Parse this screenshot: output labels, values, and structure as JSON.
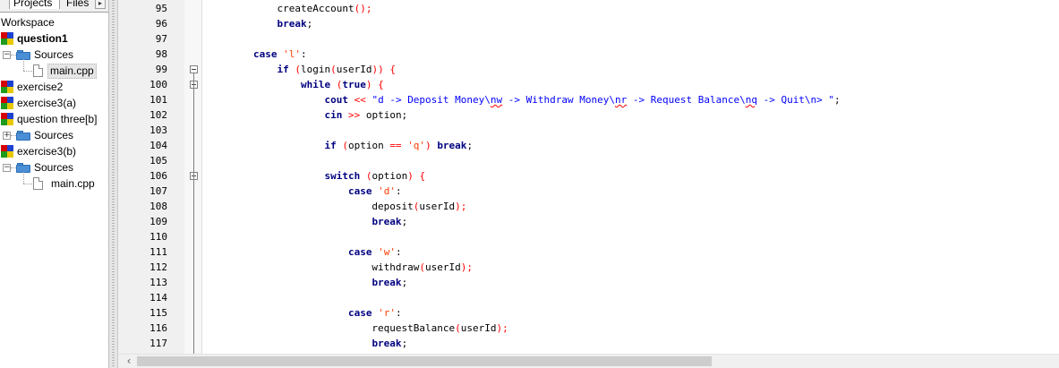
{
  "left_pane": {
    "tabs": [
      "Projects",
      "Files"
    ],
    "tab_scroll_glyph": "▸",
    "workspace_label": "Workspace",
    "tree": [
      {
        "kind": "project",
        "label": "question1",
        "bold": true
      },
      {
        "kind": "folder",
        "label": "Sources",
        "expander": "−"
      },
      {
        "kind": "file",
        "label": "main.cpp",
        "selected": true
      },
      {
        "kind": "project",
        "label": "exercise2"
      },
      {
        "kind": "project",
        "label": "exercise3(a)"
      },
      {
        "kind": "project",
        "label": "question three[b]"
      },
      {
        "kind": "folder",
        "label": "Sources",
        "expander": "+"
      },
      {
        "kind": "project",
        "label": "exercise3(b)"
      },
      {
        "kind": "folder",
        "label": "Sources",
        "expander": "−"
      },
      {
        "kind": "file",
        "label": "main.cpp"
      }
    ]
  },
  "editor": {
    "line_numbers": [
      "95",
      "96",
      "97",
      "98",
      "99",
      "100",
      "101",
      "102",
      "103",
      "104",
      "105",
      "106",
      "107",
      "108",
      "109",
      "110",
      "111",
      "112",
      "113",
      "114",
      "115",
      "116",
      "117"
    ],
    "code_lines": [
      [
        {
          "t": "            createAccount",
          "c": ""
        },
        {
          "t": "();",
          "c": "pun"
        }
      ],
      [
        {
          "t": "            ",
          "c": ""
        },
        {
          "t": "break",
          "c": "kw"
        },
        {
          "t": ";",
          "c": ""
        }
      ],
      [],
      [
        {
          "t": "        ",
          "c": ""
        },
        {
          "t": "case",
          "c": "kw"
        },
        {
          "t": " ",
          "c": ""
        },
        {
          "t": "'l'",
          "c": "ch"
        },
        {
          "t": ":",
          "c": ""
        }
      ],
      [
        {
          "t": "            ",
          "c": ""
        },
        {
          "t": "if",
          "c": "kw"
        },
        {
          "t": " ",
          "c": ""
        },
        {
          "t": "(",
          "c": "pun"
        },
        {
          "t": "login",
          "c": ""
        },
        {
          "t": "(",
          "c": "pun"
        },
        {
          "t": "userId",
          "c": ""
        },
        {
          "t": "))",
          "c": "pun"
        },
        {
          "t": " ",
          "c": ""
        },
        {
          "t": "{",
          "c": "pun"
        }
      ],
      [
        {
          "t": "                ",
          "c": ""
        },
        {
          "t": "while",
          "c": "kw"
        },
        {
          "t": " ",
          "c": ""
        },
        {
          "t": "(",
          "c": "pun"
        },
        {
          "t": "true",
          "c": "kw"
        },
        {
          "t": ")",
          "c": "pun"
        },
        {
          "t": " ",
          "c": ""
        },
        {
          "t": "{",
          "c": "pun"
        }
      ],
      [
        {
          "t": "                    ",
          "c": ""
        },
        {
          "t": "cout",
          "c": "kw"
        },
        {
          "t": " ",
          "c": ""
        },
        {
          "t": "<<",
          "c": "pun"
        },
        {
          "t": " ",
          "c": ""
        },
        {
          "t": "\"d -> Deposit Money\\",
          "c": "str"
        },
        {
          "t": "nw",
          "c": "str sq"
        },
        {
          "t": " -> Withdraw Money\\",
          "c": "str"
        },
        {
          "t": "nr",
          "c": "str sq"
        },
        {
          "t": " -> Request Balance\\",
          "c": "str"
        },
        {
          "t": "nq",
          "c": "str sq"
        },
        {
          "t": " -> Quit\\n> \"",
          "c": "str"
        },
        {
          "t": ";",
          "c": ""
        }
      ],
      [
        {
          "t": "                    ",
          "c": ""
        },
        {
          "t": "cin",
          "c": "kw"
        },
        {
          "t": " ",
          "c": ""
        },
        {
          "t": ">>",
          "c": "pun"
        },
        {
          "t": " option;",
          "c": ""
        }
      ],
      [],
      [
        {
          "t": "                    ",
          "c": ""
        },
        {
          "t": "if",
          "c": "kw"
        },
        {
          "t": " ",
          "c": ""
        },
        {
          "t": "(",
          "c": "pun"
        },
        {
          "t": "option ",
          "c": ""
        },
        {
          "t": "==",
          "c": "pun"
        },
        {
          "t": " ",
          "c": ""
        },
        {
          "t": "'q'",
          "c": "ch"
        },
        {
          "t": ")",
          "c": "pun"
        },
        {
          "t": " ",
          "c": ""
        },
        {
          "t": "break",
          "c": "kw"
        },
        {
          "t": ";",
          "c": ""
        }
      ],
      [],
      [
        {
          "t": "                    ",
          "c": ""
        },
        {
          "t": "switch",
          "c": "kw"
        },
        {
          "t": " ",
          "c": ""
        },
        {
          "t": "(",
          "c": "pun"
        },
        {
          "t": "option",
          "c": ""
        },
        {
          "t": ")",
          "c": "pun"
        },
        {
          "t": " ",
          "c": ""
        },
        {
          "t": "{",
          "c": "pun"
        }
      ],
      [
        {
          "t": "                        ",
          "c": ""
        },
        {
          "t": "case",
          "c": "kw"
        },
        {
          "t": " ",
          "c": ""
        },
        {
          "t": "'d'",
          "c": "ch"
        },
        {
          "t": ":",
          "c": ""
        }
      ],
      [
        {
          "t": "                            deposit",
          "c": ""
        },
        {
          "t": "(",
          "c": "pun"
        },
        {
          "t": "userId",
          "c": ""
        },
        {
          "t": ");",
          "c": "pun"
        }
      ],
      [
        {
          "t": "                            ",
          "c": ""
        },
        {
          "t": "break",
          "c": "kw"
        },
        {
          "t": ";",
          "c": ""
        }
      ],
      [],
      [
        {
          "t": "                        ",
          "c": ""
        },
        {
          "t": "case",
          "c": "kw"
        },
        {
          "t": " ",
          "c": ""
        },
        {
          "t": "'w'",
          "c": "ch"
        },
        {
          "t": ":",
          "c": ""
        }
      ],
      [
        {
          "t": "                            withdraw",
          "c": ""
        },
        {
          "t": "(",
          "c": "pun"
        },
        {
          "t": "userId",
          "c": ""
        },
        {
          "t": ");",
          "c": "pun"
        }
      ],
      [
        {
          "t": "                            ",
          "c": ""
        },
        {
          "t": "break",
          "c": "kw"
        },
        {
          "t": ";",
          "c": ""
        }
      ],
      [],
      [
        {
          "t": "                        ",
          "c": ""
        },
        {
          "t": "case",
          "c": "kw"
        },
        {
          "t": " ",
          "c": ""
        },
        {
          "t": "'r'",
          "c": "ch"
        },
        {
          "t": ":",
          "c": ""
        }
      ],
      [
        {
          "t": "                            requestBalance",
          "c": ""
        },
        {
          "t": "(",
          "c": "pun"
        },
        {
          "t": "userId",
          "c": ""
        },
        {
          "t": ");",
          "c": "pun"
        }
      ],
      [
        {
          "t": "                            ",
          "c": ""
        },
        {
          "t": "break",
          "c": "kw"
        },
        {
          "t": ";",
          "c": ""
        }
      ]
    ],
    "fold_markers": [
      "99",
      "100",
      "106"
    ],
    "scroll_left_glyph": "‹"
  },
  "colors": {
    "keyword": "#000080",
    "string": "#0000ff",
    "char_literal": "#ff3c00",
    "operator": "#ff0000",
    "gutter_bg": "#f0f0f0"
  }
}
